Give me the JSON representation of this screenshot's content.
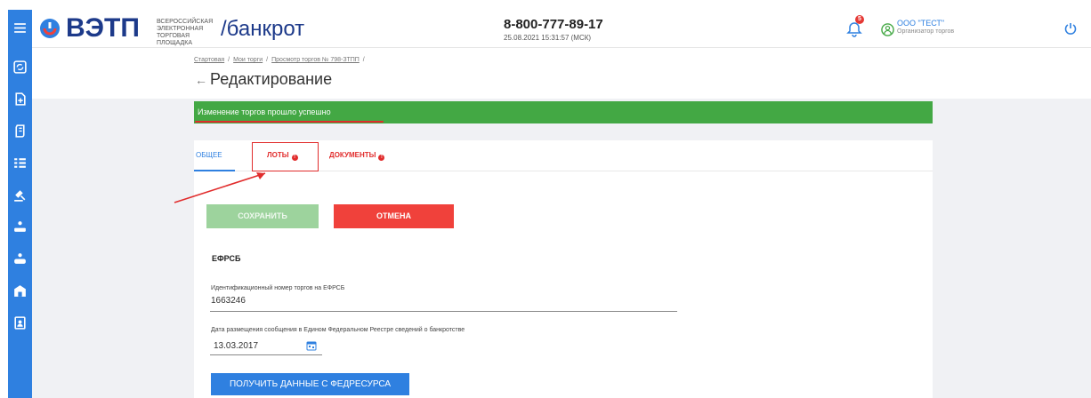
{
  "sidebar": {
    "color": "#2f80e0",
    "icons": [
      "menu-icon",
      "refresh-icon",
      "add-document-icon",
      "receipt-icon",
      "list-icon",
      "gavel-icon",
      "person-upload-icon",
      "person-download-icon",
      "bank-icon",
      "contacts-icon"
    ]
  },
  "header": {
    "logo": {
      "name": "ВЭТП",
      "sub_line1": "ВСЕРОССИЙСКАЯ",
      "sub_line2": "ЭЛЕКТРОННАЯ",
      "sub_line3": "ТОРГОВАЯ ПЛОЩАДКА",
      "section": "/банкрот"
    },
    "phone": "8-800-777-89-17",
    "datetime": "25.08.2021 15:31:57 (МСК)",
    "notifications_count": "5",
    "user_name": "ООО \"ТЕСТ\"",
    "user_role": "Организатор торгов"
  },
  "page": {
    "breadcrumb": [
      "Стартовая",
      "Мои торги",
      "Просмотр торгов № 798-ЗТПП"
    ],
    "breadcrumb_sep": "/",
    "back_icon": "arrow-left-icon",
    "title": "Редактирование"
  },
  "alert": {
    "text": "Изменение торгов прошло успешно",
    "color": "#43a844"
  },
  "tabs": [
    {
      "label": "ОБЩЕЕ",
      "active": true
    },
    {
      "label": "ЛОТЫ",
      "error": true
    },
    {
      "label": "ДОКУМЕНТЫ",
      "error": true
    }
  ],
  "error_dot_glyph": "!",
  "buttons": {
    "save": "СОХРАНИТЬ",
    "cancel": "ОТМЕНА",
    "fetch": "ПОЛУЧИТЬ ДАННЫЕ С ФЕДРЕСУРСА"
  },
  "form": {
    "section_title": "ЕФРСБ",
    "number_label": "Идентификационный номер торгов на ЕФРСБ",
    "number_value": "1663246",
    "date_label": "Дата размещения сообщения в Едином Федеральном Реестре сведений о банкротстве",
    "date_value": "13.03.2017"
  },
  "colors": {
    "primary": "#2f80e0",
    "danger": "#e12c2c",
    "success": "#43a844"
  }
}
